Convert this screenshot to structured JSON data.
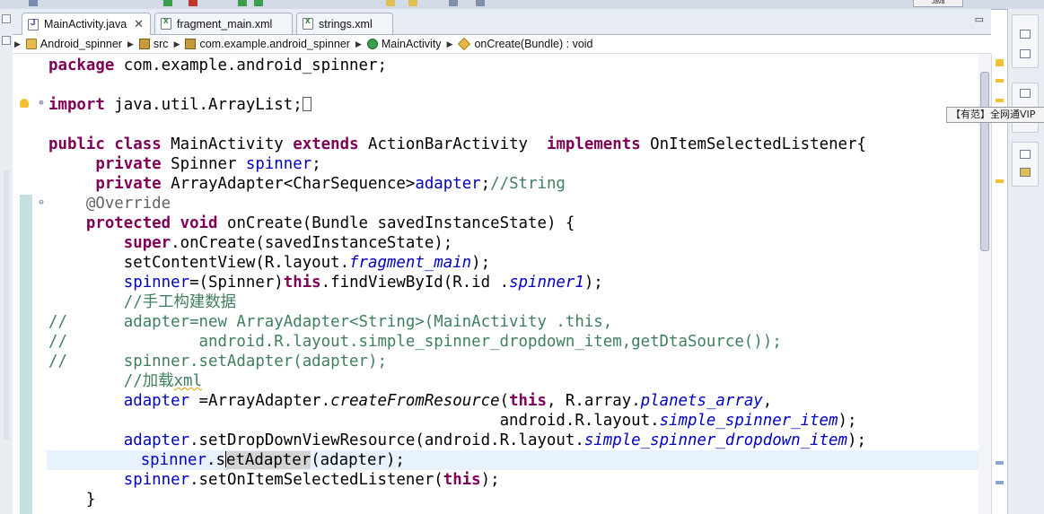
{
  "window": {
    "perspective_label": "Java"
  },
  "tabs": [
    {
      "label": "MainActivity.java",
      "type": "java",
      "active": true,
      "close": "✕"
    },
    {
      "label": "fragment_main.xml",
      "type": "xml",
      "active": false
    },
    {
      "label": "strings.xml",
      "type": "xml",
      "active": false
    }
  ],
  "breadcrumb": [
    {
      "label": "Android_spinner",
      "icon": "project-icon"
    },
    {
      "label": "src",
      "icon": "folder-icon"
    },
    {
      "label": "com.example.android_spinner",
      "icon": "package-icon"
    },
    {
      "label": "MainActivity",
      "icon": "class-icon"
    },
    {
      "label": "onCreate(Bundle) : void",
      "icon": "method-icon"
    }
  ],
  "code": {
    "l01_kw": "package",
    "l01_rest": " com.example.android_spinner;",
    "l03_kw": "import",
    "l03_rest": " java.util.ArrayList;",
    "l05_kw1": "public",
    "l05_kw2": "class",
    "l05_name": " MainActivity ",
    "l05_kw3": "extends",
    "l05_base": " ActionBarActivity  ",
    "l05_kw4": "implements",
    "l05_iface": " OnItemSelectedListener{",
    "l06_kw": "private",
    "l06_type": " Spinner ",
    "l06_field": "spinner",
    "l06_end": ";",
    "l07_kw": "private",
    "l07_type": " ArrayAdapter<CharSequence>",
    "l07_field": "adapter",
    "l07_end": ";",
    "l07_cmt": "//String",
    "l08_ann": "@Override",
    "l09_kw1": "protected",
    "l09_kw2": "void",
    "l09_rest": " onCreate(Bundle savedInstanceState) {",
    "l10_kw": "super",
    "l10_rest": ".onCreate(savedInstanceState);",
    "l11_a": "setContentView(R.layout.",
    "l11_b": "fragment_main",
    "l11_c": ");",
    "l12_field": "spinner",
    "l12_a": "=(Spinner)",
    "l12_kw": "this",
    "l12_b": ".findViewById(R.id .",
    "l12_c": "spinner1",
    "l12_d": ");",
    "l13_cmt": "//手工构建数据",
    "l14_cmt": "//      adapter=new ArrayAdapter<String>(MainActivity .this,",
    "l15_cmt": "//              android.R.layout.simple_spinner_dropdown_item,getDtaSource());",
    "l16_cmt": "//      spinner.setAdapter(adapter);",
    "l17_cmt_a": "//加载",
    "l17_cmt_b": "xml",
    "l18_field": "adapter",
    "l18_a": " =ArrayAdapter.",
    "l18_b": "createFromResource",
    "l18_c": "(",
    "l18_kw": "this",
    "l18_d": ", R.array.",
    "l18_e": "planets_array",
    "l18_f": ",",
    "l19_a": "android.R.layout.",
    "l19_b": "simple_spinner_item",
    "l19_c": ");",
    "l20_field": "adapter",
    "l20_a": ".setDropDownViewResource(android.R.layout.",
    "l20_b": "simple_spinner_dropdown_item",
    "l20_c": ");",
    "l21_field": "spinner",
    "l21_dot": ".",
    "l21_s": "s",
    "l21_hl": "etAdapter",
    "l21_rest": "(adapter);",
    "l22_field": "spinner",
    "l22_a": ".setOnItemSelectedListener(",
    "l22_kw": "this",
    "l22_b": ");",
    "l23": "}"
  },
  "tooltip": "【有范】全网通VIP"
}
